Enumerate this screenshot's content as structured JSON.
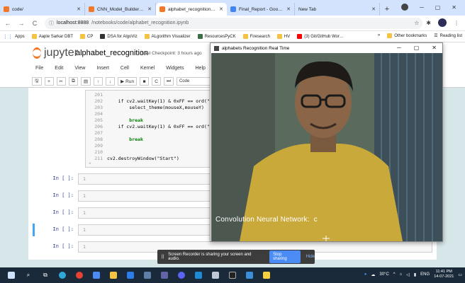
{
  "browser": {
    "tabs": [
      {
        "label": "code/",
        "color": "#f37726",
        "active": false
      },
      {
        "label": "CNN_Model_Builder - Ju…",
        "color": "#f37726",
        "active": false
      },
      {
        "label": "alphabet_recognition - Ju…",
        "color": "#f37726",
        "active": true
      },
      {
        "label": "Final_Report - Google Do…",
        "color": "#4285f4",
        "active": false
      },
      {
        "label": "New Tab",
        "color": "#ffffff",
        "active": false
      }
    ],
    "new_tab": "+",
    "url_host": "localhost:8888",
    "url_path": "/notebooks/code/alphabet_recognition.ipynb",
    "bookmarks": [
      "Apps",
      "Aaple Sarkar DBT",
      "CP",
      "DSA for AlgoViz",
      "ALgorithm Visualizer",
      "ResourcesPyCK",
      "Firesearch",
      "HV",
      "(3) Git/GitHub Wor…"
    ],
    "bookmarks_right": [
      "»",
      "Other bookmarks",
      "Reading list"
    ]
  },
  "jupyter": {
    "logo_text": "jupyter",
    "notebook_name": "alphabet_recognition",
    "checkpoint": "Last Checkpoint: 3 hours ago",
    "menu": [
      "File",
      "Edit",
      "View",
      "Insert",
      "Cell",
      "Kernel",
      "Widgets",
      "Help"
    ],
    "toolbar": {
      "run_label": "Run",
      "cell_type": "Code"
    },
    "code_lines": [
      {
        "n": "201",
        "t": ""
      },
      {
        "n": "202",
        "t": "    if cv2.waitKey(1) & 0xFF == ord(\"a\"):"
      },
      {
        "n": "203",
        "t": "        select_theme(mouseX,mouseY)"
      },
      {
        "n": "204",
        "t": ""
      },
      {
        "n": "205",
        "t": "        break"
      },
      {
        "n": "206",
        "t": "    if cv2.waitKey(1) & 0xFF == ord(\"q\"):"
      },
      {
        "n": "207",
        "t": ""
      },
      {
        "n": "208",
        "t": "        break"
      },
      {
        "n": "209",
        "t": ""
      },
      {
        "n": "210",
        "t": ""
      },
      {
        "n": "211",
        "t": "cv2.destroyWindow(\"Start\")"
      }
    ],
    "empty_cells": [
      {
        "prompt": "In [ ]:",
        "line": "1"
      },
      {
        "prompt": "In [ ]:",
        "line": "1"
      },
      {
        "prompt": "In [ ]:",
        "line": "1"
      },
      {
        "prompt": "In [ ]:",
        "line": "1"
      },
      {
        "prompt": "In [ ]:",
        "line": "1"
      }
    ]
  },
  "video_window": {
    "title": "alphabets Recognition Real Time",
    "caption": "Convolution Neural Network:  c"
  },
  "recorder": {
    "message": "Screen Recorder is sharing your screen and audio.",
    "stop_label": "Stop sharing",
    "hide_label": "Hide"
  },
  "taskbar": {
    "weather": "30°C",
    "lang": "ENG",
    "time": "11:41 PM",
    "date": "14-07-2021"
  }
}
